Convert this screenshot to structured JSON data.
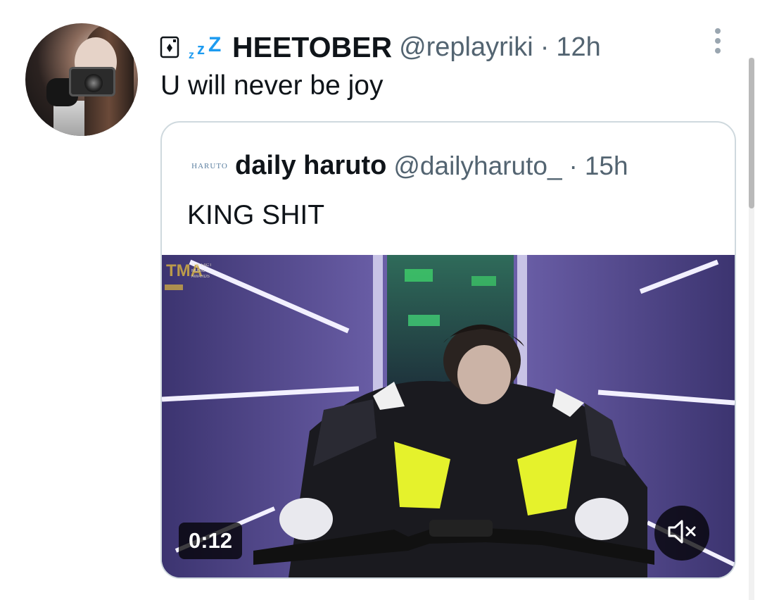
{
  "tweet": {
    "display_name": "HEETOBER",
    "handle": "@replayriki",
    "separator": "·",
    "time": "12h",
    "text": "U will never be joy",
    "name_emojis": [
      "joker-card-icon",
      "zzz-icon"
    ]
  },
  "quoted_tweet": {
    "avatar_text": "HARUTO",
    "display_name": "daily haruto",
    "handle": "@dailyharuto_",
    "separator": "·",
    "time": "15h",
    "text": "KING SHIT",
    "media": {
      "type": "video",
      "duration": "0:12",
      "watermark_logo": "TMA THE FACT MUSIC AWARDS",
      "muted": true
    }
  },
  "colors": {
    "text_primary": "#0f1419",
    "text_secondary": "#536471",
    "border": "#cfd9de",
    "zzz_blue": "#1d9bf0"
  }
}
